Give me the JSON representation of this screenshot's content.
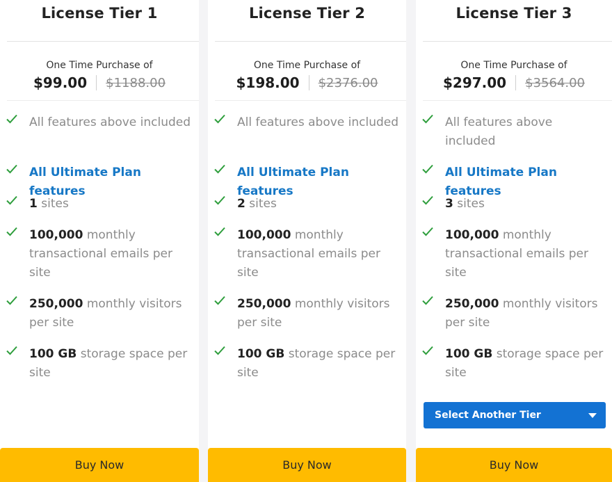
{
  "tiers": [
    {
      "title": "License Tier 1",
      "purchase_label": "One Time Purchase of",
      "price": "$99.00",
      "original_price": "$1188.00",
      "features": {
        "all_features": "All features above included",
        "ultimate": "All Ultimate Plan features",
        "sites_count": "1",
        "sites_text": " sites",
        "emails_count": "100,000",
        "emails_text": " monthly transactional emails per site",
        "visitors_count": "250,000",
        "visitors_text": " monthly visitors per site",
        "storage_count": "100 GB",
        "storage_text": " storage space per site"
      },
      "buy_label": "Buy Now"
    },
    {
      "title": "License Tier 2",
      "purchase_label": "One Time Purchase of",
      "price": "$198.00",
      "original_price": "$2376.00",
      "features": {
        "all_features": "All features above included",
        "ultimate": "All Ultimate Plan features",
        "sites_count": "2",
        "sites_text": " sites",
        "emails_count": "100,000",
        "emails_text": " monthly transactional emails per site",
        "visitors_count": "250,000",
        "visitors_text": " monthly visitors per site",
        "storage_count": "100 GB",
        "storage_text": " storage space per site"
      },
      "buy_label": "Buy Now"
    },
    {
      "title": "License Tier 3",
      "purchase_label": "One Time Purchase of",
      "price": "$297.00",
      "original_price": "$3564.00",
      "features": {
        "all_features": "All features above included",
        "ultimate": "All Ultimate Plan features",
        "sites_count": "3",
        "sites_text": " sites",
        "emails_count": "100,000",
        "emails_text": " monthly transactional emails per site",
        "visitors_count": "250,000",
        "visitors_text": " monthly visitors per site",
        "storage_count": "100 GB",
        "storage_text": " storage space per site"
      },
      "select_label": "Select Another Tier",
      "buy_label": "Buy Now"
    }
  ],
  "icons": {
    "check": "check-icon",
    "caret": "chevron-down-icon"
  },
  "colors": {
    "check": "#2e9e3c",
    "link_blue": "#1778c6",
    "select_button": "#1372d3",
    "buy_button": "#ffbb00"
  }
}
